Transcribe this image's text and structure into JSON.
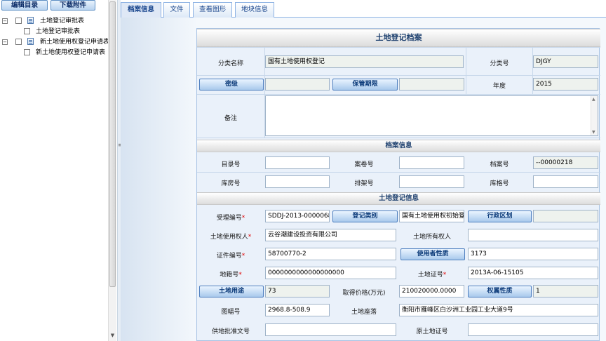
{
  "toolbar": {
    "edit_catalog": "编辑目录",
    "download_attachment": "下载附件"
  },
  "tree": {
    "nodes": [
      {
        "label": "土地登记审批表"
      },
      {
        "label": "土地登记审批表"
      },
      {
        "label": "新土地使用权登记申请表"
      },
      {
        "label": "新土地使用权登记申请表"
      }
    ]
  },
  "tabs": [
    {
      "label": "档案信息"
    },
    {
      "label": "文件"
    },
    {
      "label": "查看图形"
    },
    {
      "label": "地块信息"
    }
  ],
  "form": {
    "title": "土地登记档案",
    "category_name_label": "分类名称",
    "category_name_value": "国有土地使用权登记",
    "category_no_label": "分类号",
    "category_no_value": "DJGY",
    "secret_level_button": "密级",
    "secret_level_value": "",
    "retention_button": "保管期限",
    "retention_value": "",
    "year_label": "年度",
    "year_value": "2015",
    "remark_label": "备注",
    "archive_section": "档案信息",
    "catalog_no_label": "目录号",
    "catalog_no_value": "",
    "case_no_label": "案卷号",
    "case_no_value": "",
    "archive_no_label": "档案号",
    "archive_no_value": "--00000218",
    "warehouse_label": "库房号",
    "warehouse_value": "",
    "shelf_label": "排架号",
    "shelf_value": "",
    "cabinet_label": "库格号",
    "cabinet_value": "",
    "land_section": "土地登记信息",
    "accept_no_label": "受理编号",
    "accept_no_value": "SDDJ-2013-0000068",
    "reg_type_button": "登记类别",
    "reg_type_value": "国有土地使用权初始登记",
    "admin_area_button": "行政区划",
    "admin_area_value": "",
    "land_user_label": "土地使用权人",
    "land_user_value": "云谷潮建设投资有限公司",
    "land_owner_label": "土地所有权人",
    "land_owner_value": "",
    "cert_no_label": "证件编号",
    "cert_no_value": "58700770-2",
    "user_nature_button": "使用者性质",
    "user_nature_value": "3173",
    "parcel_no_label": "地籍号",
    "parcel_no_value": "0000000000000000000",
    "land_cert_label": "土地证号",
    "land_cert_value": "2013A-06-15105",
    "land_use_button": "土地用途",
    "land_use_value": "73",
    "price_label": "取得价格(万元)",
    "price_value": "210020000.0000",
    "ownership_button": "权属性质",
    "ownership_value": "1",
    "map_no_label": "图幅号",
    "map_no_value": "2968.8-508.9",
    "location_label": "土地座落",
    "location_value": "衡阳市雁峰区白沙洲工业园工业大道9号",
    "approval_doc_label": "供地批准文号",
    "approval_doc_value": "",
    "orig_cert_label": "原土地证号",
    "orig_cert_value": ""
  }
}
